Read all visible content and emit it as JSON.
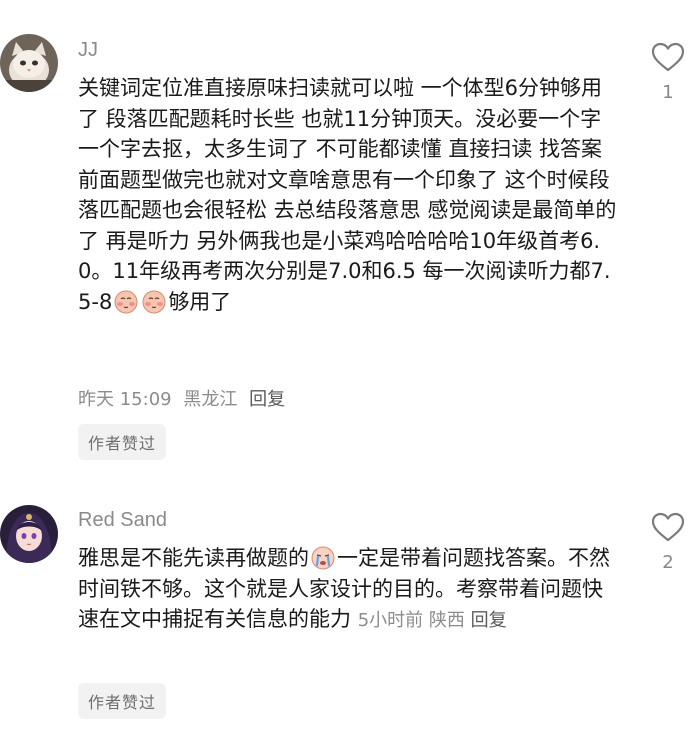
{
  "comments": [
    {
      "username": "JJ",
      "text_part1": "关键词定位准直接原味扫读就可以啦 一个体型6分钟够用了 段落匹配题耗时长些 也就11分钟顶天。没必要一个字一个字去抠，太多生词了 不可能都读懂 直接扫读 找答案 前面题型做完也就对文章啥意思有一个印象了 这个时候段落匹配题也会很轻松 去总结段落意思 感觉阅读是最简单的了 再是听力 另外俩我也是小菜鸡哈哈哈哈10年级首考6.0。11年级再考两次分别是7.0和6.5 每一次阅读听力都7.5-8",
      "text_part2": "够用了",
      "time": "昨天 15:09",
      "location": "黑龙江",
      "reply": "回复",
      "badge": "作者赞过",
      "likes": "1"
    },
    {
      "username": "Red Sand",
      "text_part1": "雅思是不能先读再做题的",
      "text_part2": "一定是带着问题找答案。不然时间铁不够。这个就是人家设计的目的。考察带着问题快速在文中捕捉有关信息的能力",
      "time": "5小时前",
      "location": "陕西",
      "reply": "回复",
      "badge": "作者赞过",
      "likes": "2"
    }
  ],
  "icons": {
    "like": "heart-outline-icon",
    "emoji_blush": "blush-face-emoji",
    "emoji_cry": "crying-face-emoji"
  },
  "colors": {
    "meta": "#8c8c8c",
    "badge_bg": "#f2f2f2",
    "text": "#1a1a1a"
  }
}
